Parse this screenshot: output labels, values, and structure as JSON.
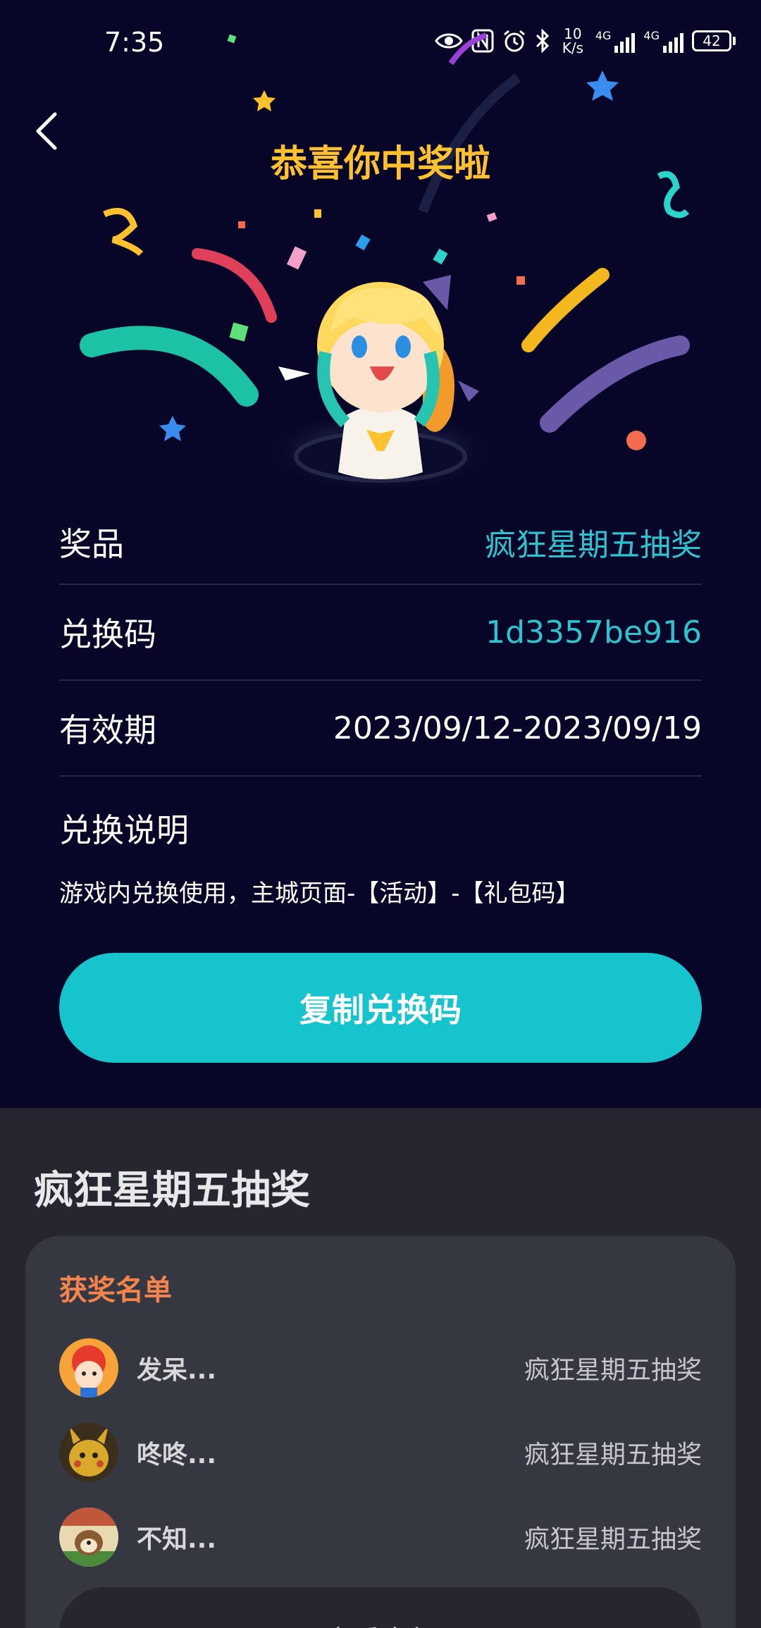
{
  "status_bar": {
    "time": "7:35",
    "net_speed_value": "10",
    "net_speed_unit": "K/s",
    "signal1_label": "4G",
    "signal2_label": "4G",
    "battery": "42"
  },
  "header": {
    "title": "恭喜你中奖啦",
    "back_icon": "chevron-left-icon"
  },
  "prize_info": {
    "prize_label": "奖品",
    "prize_value": "疯狂星期五抽奖",
    "code_label": "兑换码",
    "code_value": "1d3357be916",
    "validity_label": "有效期",
    "validity_value": "2023/09/12-2023/09/19",
    "instructions_label": "兑换说明",
    "instructions_text": "游戏内兑换使用，主城页面-【活动】-【礼包码】"
  },
  "copy_button_label": "复制兑换码",
  "lottery": {
    "title": "疯狂星期五抽奖",
    "winners_title": "获奖名单",
    "winners": [
      {
        "name": "发呆...",
        "prize": "疯狂星期五抽奖"
      },
      {
        "name": "咚咚...",
        "prize": "疯狂星期五抽奖"
      },
      {
        "name": "不知...",
        "prize": "疯狂星期五抽奖"
      }
    ],
    "view_all_label": "查看全部"
  },
  "colors": {
    "background": "#070629",
    "title_gold": "#ffc22e",
    "accent_teal": "#15c4cc",
    "winners_title_orange": "#f4834c",
    "panel": "#25262f",
    "card": "#353841"
  }
}
